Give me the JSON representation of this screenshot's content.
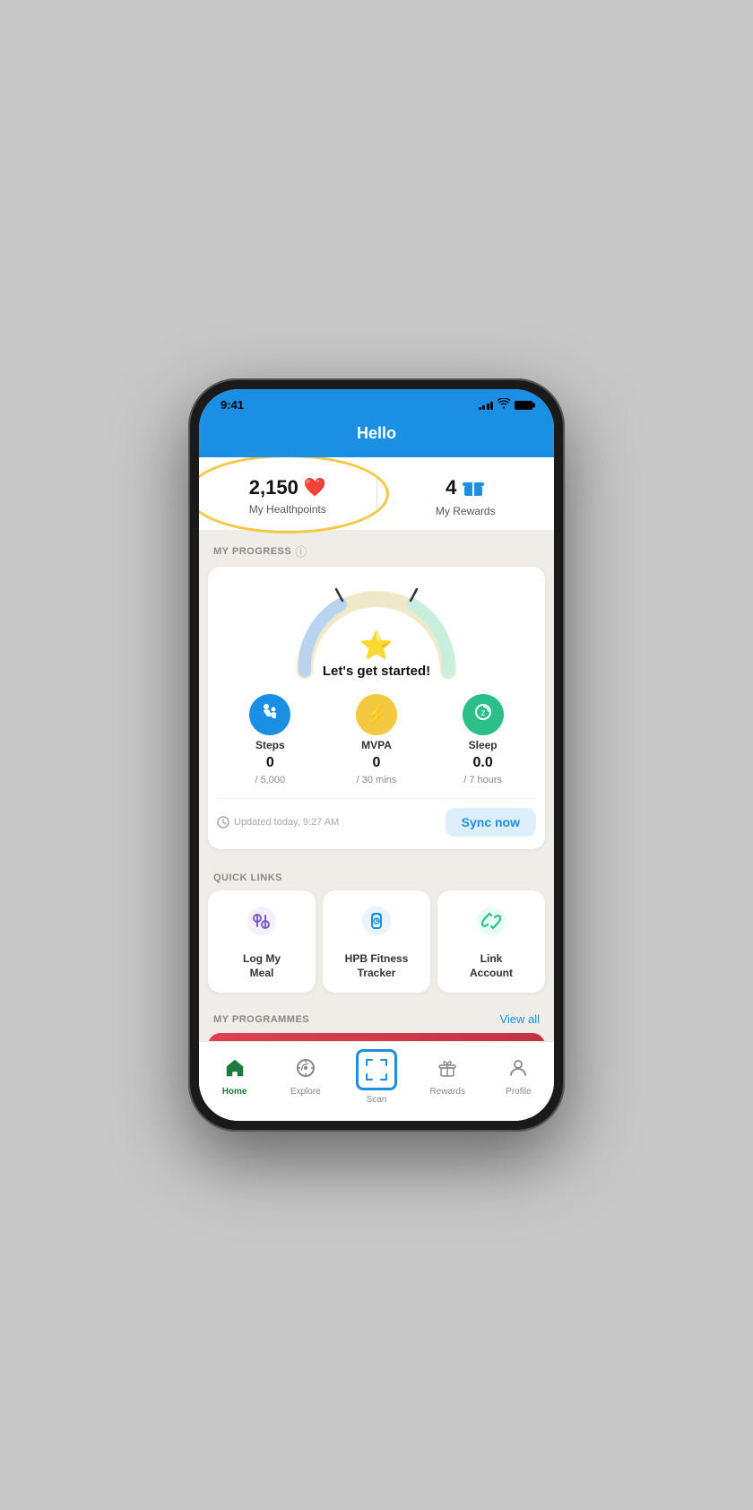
{
  "status": {
    "time": "9:41",
    "signal_bars": [
      3,
      5,
      7,
      9,
      11
    ],
    "battery_full": true
  },
  "header": {
    "title": "Hello"
  },
  "stats": {
    "healthpoints_value": "2,150",
    "healthpoints_label": "My Healthpoints",
    "rewards_value": "4",
    "rewards_label": "My Rewards"
  },
  "progress": {
    "section_title": "MY PROGRESS",
    "card_label": "Let's get started!",
    "metrics": [
      {
        "name": "Steps",
        "value": "0",
        "target": "/ 5,000",
        "icon": "👟",
        "color": "blue"
      },
      {
        "name": "MVPA",
        "value": "0",
        "target": "/ 30 mins",
        "icon": "⚡",
        "color": "yellow"
      },
      {
        "name": "Sleep",
        "value": "0.0",
        "target": "/ 7 hours",
        "icon": "😴",
        "color": "green"
      }
    ],
    "sync_time": "Updated today, 9:27 AM",
    "sync_btn_label": "Sync now"
  },
  "quick_links": {
    "section_title": "QUICK LINKS",
    "items": [
      {
        "label": "Log My\nMeal",
        "icon": "🍽️"
      },
      {
        "label": "HPB Fitness\nTracker",
        "icon": "⌚"
      },
      {
        "label": "Link\nAccount",
        "icon": "🔗"
      }
    ]
  },
  "programmes": {
    "section_title": "MY PROGRAMMES",
    "view_all_label": "View all"
  },
  "bottom_nav": {
    "items": [
      {
        "label": "Home",
        "icon": "🏠",
        "active": true
      },
      {
        "label": "Explore",
        "icon": "🧭",
        "active": false
      },
      {
        "label": "Scan",
        "icon": "⬜",
        "active": false,
        "is_scan": true
      },
      {
        "label": "Rewards",
        "icon": "🎁",
        "active": false
      },
      {
        "label": "Profile",
        "icon": "👤",
        "active": false
      }
    ]
  }
}
